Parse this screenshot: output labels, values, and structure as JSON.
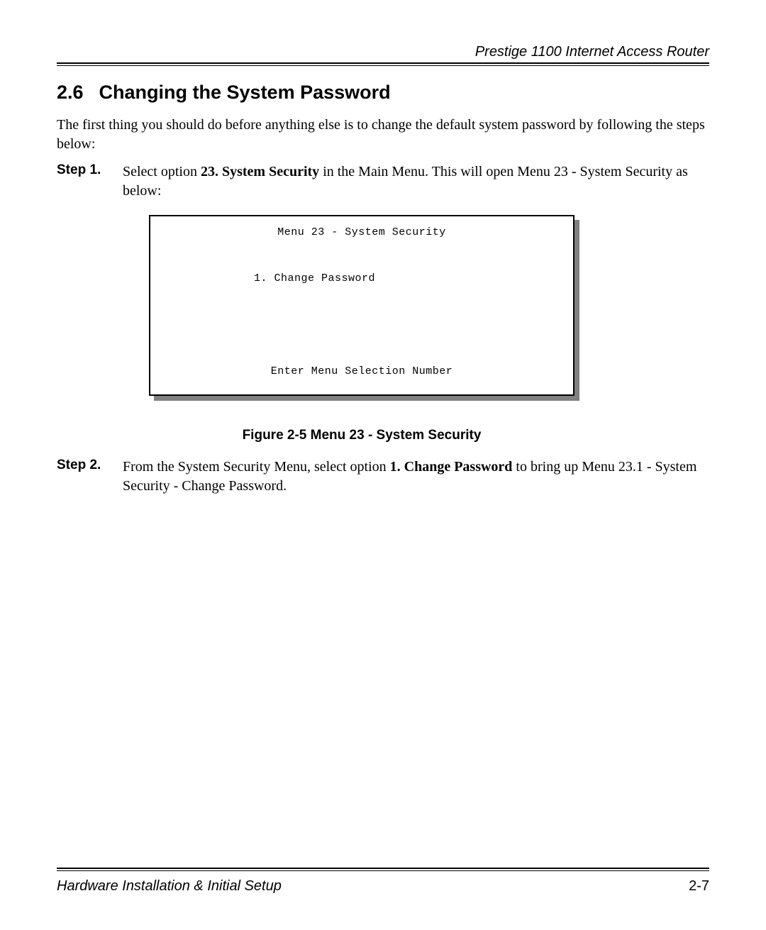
{
  "header": {
    "product": "Prestige 1100 Internet Access Router"
  },
  "section": {
    "number": "2.6",
    "title": "Changing the System Password"
  },
  "intro": "The first thing you should do before anything else is to change the default system password by following the steps below:",
  "step1": {
    "label": "Step 1.",
    "pre": "Select option ",
    "bold": "23. System Security",
    "post": " in the Main Menu. This will open Menu 23 - System Security as below:"
  },
  "terminal": {
    "title": "Menu 23 - System Security",
    "option": "1. Change Password",
    "prompt": "Enter Menu Selection Number"
  },
  "figure_caption": "Figure 2-5 Menu 23 - System Security",
  "step2": {
    "label": "Step 2.",
    "pre": "From the System Security Menu, select option ",
    "bold": "1. Change Password",
    "post": " to bring up Menu 23.1 - System Security - Change Password."
  },
  "footer": {
    "left": "Hardware Installation & Initial Setup",
    "right": "2-7"
  }
}
